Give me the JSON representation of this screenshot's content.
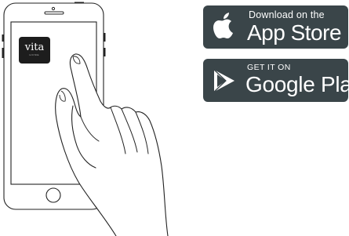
{
  "app_icon": {
    "name": "vita",
    "subtitle": "HOME"
  },
  "app_store": {
    "line1": "Download on the",
    "line2": "App Store"
  },
  "google_play": {
    "line1": "GET IT ON",
    "line2": "Google Play"
  },
  "colors": {
    "badge_bg": "#3a4549",
    "outline": "#222222",
    "app_icon_bg": "#1d1d1d"
  }
}
